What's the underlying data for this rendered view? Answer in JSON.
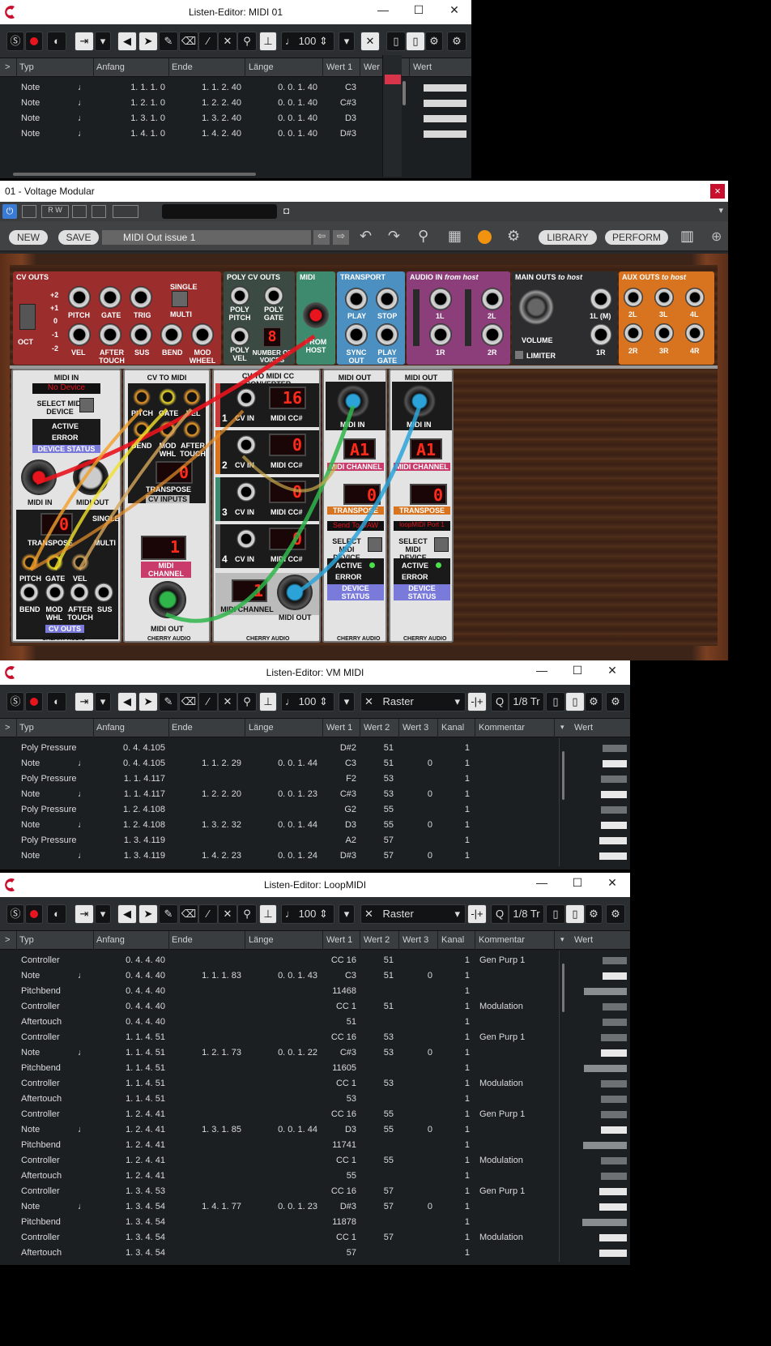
{
  "win1": {
    "title": "Listen-Editor: MIDI 01",
    "headers": [
      "Typ",
      "Anfang",
      "Ende",
      "Länge",
      "Wert 1",
      "Wer",
      "Wert"
    ],
    "quantize": "100",
    "rows": [
      {
        "typ": "Note",
        "anfang": "1. 1. 1.   0",
        "ende": "1. 1. 2. 40",
        "laenge": "0. 0. 1. 40",
        "w1": "C3",
        "bar": 0.95
      },
      {
        "typ": "Note",
        "anfang": "1. 2. 1.   0",
        "ende": "1. 2. 2. 40",
        "laenge": "0. 0. 1. 40",
        "w1": "C#3",
        "bar": 0.95
      },
      {
        "typ": "Note",
        "anfang": "1. 3. 1.   0",
        "ende": "1. 3. 2. 40",
        "laenge": "0. 0. 1. 40",
        "w1": "D3",
        "bar": 0.95
      },
      {
        "typ": "Note",
        "anfang": "1. 4. 1.   0",
        "ende": "1. 4. 2. 40",
        "laenge": "0. 0. 1. 40",
        "w1": "D#3",
        "bar": 0.95
      }
    ]
  },
  "vm": {
    "title": "01 - Voltage Modular",
    "close": "×",
    "buttons": {
      "new": "NEW",
      "save": "SAVE",
      "library": "LIBRARY",
      "perform": "PERFORM"
    },
    "preset": "MIDI Out issue 1",
    "modules": {
      "cv_outs": "CV OUTS",
      "oct": "OCT",
      "single": "SINGLE",
      "multi": "MULTI",
      "pitch": "PITCH",
      "gate": "GATE",
      "trig": "TRIG",
      "vel": "VEL",
      "aftertouch": "AFTER TOUCH",
      "sus": "SUS",
      "bend": "BEND",
      "modwheel": "MOD WHEEL",
      "oct_vals": [
        "+2",
        "+1",
        "0",
        "-1",
        "-2"
      ],
      "poly_cv": "POLY CV OUTS",
      "poly_pitch": "POLY PITCH",
      "poly_gate": "POLY GATE",
      "poly_vel": "POLY VEL",
      "voices": "NUMBER OF VOICES",
      "voices_val": "8",
      "midi": "MIDI",
      "from_host": "FROM HOST",
      "transport": "TRANSPORT",
      "play": "PLAY",
      "stop": "STOP",
      "sync_out": "SYNC OUT",
      "play_gate": "PLAY GATE",
      "audio_in": "AUDIO IN",
      "from_host_it": "from host",
      "l1": "1L",
      "l2": "2L",
      "r1": "1R",
      "r2": "2R",
      "main_outs": "MAIN OUTS",
      "to_host": "to host",
      "volume": "VOLUME",
      "limiter": "LIMITER",
      "l1m": "1L (M)",
      "aux_outs": "AUX OUTS",
      "aux": [
        "2L",
        "3L",
        "4L",
        "2R",
        "3R",
        "4R"
      ],
      "midi_in": "MIDI IN",
      "no_device": "No Device",
      "select_dev": "SELECT MIDI DEVICE",
      "active": "ACTIVE",
      "error": "ERROR",
      "dev_status": "DEVICE STATUS",
      "midi_out_lbl": "MIDI OUT",
      "transpose": "TRANSPOSE",
      "transpose_val": "0",
      "cv_to_midi": "CV TO MIDI",
      "cv_inputs": "CV INPUTS",
      "midi_channel": "MIDI CHANNEL",
      "ch_val": "1",
      "mod_whl": "MOD WHL",
      "cv_cc": "CV TO MIDI CC CONVERTER",
      "cv_in": "CV IN",
      "midi_cc": "MIDI CC#",
      "cc_vals": [
        "16",
        "0",
        "0",
        "0"
      ],
      "cc_nums": [
        "1",
        "2",
        "3",
        "4"
      ],
      "midi_out": "MIDI OUT",
      "ch_a1": "A1",
      "send_daw": "Send To DAW",
      "loopmidi": "loopMIDI Port 1",
      "maker": "CHERRY AUDIO"
    }
  },
  "win2": {
    "title": "Listen-Editor: VM MIDI",
    "raster": "Raster",
    "quant": "1/8",
    "tr": "Tr",
    "quantize": "100",
    "headers": [
      "Typ",
      "Anfang",
      "Ende",
      "Länge",
      "Wert 1",
      "Wert 2",
      "Wert 3",
      "Kanal",
      "Kommentar",
      "Wert"
    ],
    "rows": [
      {
        "typ": "Poly Pressure",
        "note": false,
        "anfang": "0. 4. 4.105",
        "ende": "",
        "laenge": "",
        "w1": "D#2",
        "w2": "51",
        "w3": "",
        "k": "1",
        "c": "",
        "bar": 0.4
      },
      {
        "typ": "Note",
        "note": true,
        "anfang": "0. 4. 4.105",
        "ende": "1. 1. 2. 29",
        "laenge": "0. 0. 1. 44",
        "w1": "C3",
        "w2": "51",
        "w3": "0",
        "k": "1",
        "c": "",
        "bar": 0.4
      },
      {
        "typ": "Poly Pressure",
        "note": false,
        "anfang": "1. 1. 4.117",
        "ende": "",
        "laenge": "",
        "w1": "F2",
        "w2": "53",
        "w3": "",
        "k": "1",
        "c": "",
        "bar": 0.42
      },
      {
        "typ": "Note",
        "note": true,
        "anfang": "1. 1. 4.117",
        "ende": "1. 2. 2. 20",
        "laenge": "0. 0. 1. 23",
        "w1": "C#3",
        "w2": "53",
        "w3": "0",
        "k": "1",
        "c": "",
        "bar": 0.42
      },
      {
        "typ": "Poly Pressure",
        "note": false,
        "anfang": "1. 2. 4.108",
        "ende": "",
        "laenge": "",
        "w1": "G2",
        "w2": "55",
        "w3": "",
        "k": "1",
        "c": "",
        "bar": 0.43
      },
      {
        "typ": "Note",
        "note": true,
        "anfang": "1. 2. 4.108",
        "ende": "1. 3. 2. 32",
        "laenge": "0. 0. 1. 44",
        "w1": "D3",
        "w2": "55",
        "w3": "0",
        "k": "1",
        "c": "",
        "bar": 0.43
      },
      {
        "typ": "Poly Pressure",
        "note": false,
        "anfang": "1. 3. 4.119",
        "ende": "",
        "laenge": "",
        "w1": "A2",
        "w2": "57",
        "w3": "",
        "k": "1",
        "c": "",
        "bar": 0.45
      },
      {
        "typ": "Note",
        "note": true,
        "anfang": "1. 3. 4.119",
        "ende": "1. 4. 2. 23",
        "laenge": "0. 0. 1. 24",
        "w1": "D#3",
        "w2": "57",
        "w3": "0",
        "k": "1",
        "c": "",
        "bar": 0.45
      }
    ]
  },
  "win3": {
    "title": "Listen-Editor: LoopMIDI",
    "raster": "Raster",
    "quant": "1/8",
    "tr": "Tr",
    "quantize": "100",
    "headers": [
      "Typ",
      "Anfang",
      "Ende",
      "Länge",
      "Wert 1",
      "Wert 2",
      "Wert 3",
      "Kanal",
      "Kommentar",
      "Wert"
    ],
    "rows": [
      {
        "typ": "Controller",
        "note": false,
        "anfang": "0. 4. 4. 40",
        "ende": "",
        "laenge": "",
        "w1": "CC 16",
        "w2": "51",
        "w3": "",
        "k": "1",
        "c": "Gen Purp 1",
        "bar": 0.4
      },
      {
        "typ": "Note",
        "note": true,
        "anfang": "0. 4. 4. 40",
        "ende": "1. 1. 1. 83",
        "laenge": "0. 0. 1. 43",
        "w1": "C3",
        "w2": "51",
        "w3": "0",
        "k": "1",
        "c": "",
        "bar": 0.4
      },
      {
        "typ": "Pitchbend",
        "note": false,
        "anfang": "0. 4. 4. 40",
        "ende": "",
        "laenge": "",
        "w1": "11468",
        "w2": "",
        "w3": "",
        "k": "1",
        "c": "",
        "bar": 0.7
      },
      {
        "typ": "Controller",
        "note": false,
        "anfang": "0. 4. 4. 40",
        "ende": "",
        "laenge": "",
        "w1": "CC 1",
        "w2": "51",
        "w3": "",
        "k": "1",
        "c": "Modulation",
        "bar": 0.4
      },
      {
        "typ": "Aftertouch",
        "note": false,
        "anfang": "0. 4. 4. 40",
        "ende": "",
        "laenge": "",
        "w1": "51",
        "w2": "",
        "w3": "",
        "k": "1",
        "c": "",
        "bar": 0.4
      },
      {
        "typ": "Controller",
        "note": false,
        "anfang": "1. 1. 4. 51",
        "ende": "",
        "laenge": "",
        "w1": "CC 16",
        "w2": "53",
        "w3": "",
        "k": "1",
        "c": "Gen Purp 1",
        "bar": 0.42
      },
      {
        "typ": "Note",
        "note": true,
        "anfang": "1. 1. 4. 51",
        "ende": "1. 2. 1. 73",
        "laenge": "0. 0. 1. 22",
        "w1": "C#3",
        "w2": "53",
        "w3": "0",
        "k": "1",
        "c": "",
        "bar": 0.42
      },
      {
        "typ": "Pitchbend",
        "note": false,
        "anfang": "1. 1. 4. 51",
        "ende": "",
        "laenge": "",
        "w1": "11605",
        "w2": "",
        "w3": "",
        "k": "1",
        "c": "",
        "bar": 0.71
      },
      {
        "typ": "Controller",
        "note": false,
        "anfang": "1. 1. 4. 51",
        "ende": "",
        "laenge": "",
        "w1": "CC 1",
        "w2": "53",
        "w3": "",
        "k": "1",
        "c": "Modulation",
        "bar": 0.42
      },
      {
        "typ": "Aftertouch",
        "note": false,
        "anfang": "1. 1. 4. 51",
        "ende": "",
        "laenge": "",
        "w1": "53",
        "w2": "",
        "w3": "",
        "k": "1",
        "c": "",
        "bar": 0.42
      },
      {
        "typ": "Controller",
        "note": false,
        "anfang": "1. 2. 4. 41",
        "ende": "",
        "laenge": "",
        "w1": "CC 16",
        "w2": "55",
        "w3": "",
        "k": "1",
        "c": "Gen Purp 1",
        "bar": 0.43
      },
      {
        "typ": "Note",
        "note": true,
        "anfang": "1. 2. 4. 41",
        "ende": "1. 3. 1. 85",
        "laenge": "0. 0. 1. 44",
        "w1": "D3",
        "w2": "55",
        "w3": "0",
        "k": "1",
        "c": "",
        "bar": 0.43
      },
      {
        "typ": "Pitchbend",
        "note": false,
        "anfang": "1. 2. 4. 41",
        "ende": "",
        "laenge": "",
        "w1": "11741",
        "w2": "",
        "w3": "",
        "k": "1",
        "c": "",
        "bar": 0.72
      },
      {
        "typ": "Controller",
        "note": false,
        "anfang": "1. 2. 4. 41",
        "ende": "",
        "laenge": "",
        "w1": "CC 1",
        "w2": "55",
        "w3": "",
        "k": "1",
        "c": "Modulation",
        "bar": 0.43
      },
      {
        "typ": "Aftertouch",
        "note": false,
        "anfang": "1. 2. 4. 41",
        "ende": "",
        "laenge": "",
        "w1": "55",
        "w2": "",
        "w3": "",
        "k": "1",
        "c": "",
        "bar": 0.43
      },
      {
        "typ": "Controller",
        "note": false,
        "anfang": "1. 3. 4. 53",
        "ende": "",
        "laenge": "",
        "w1": "CC 16",
        "w2": "57",
        "w3": "",
        "k": "1",
        "c": "Gen Purp 1",
        "bar": 0.45
      },
      {
        "typ": "Note",
        "note": true,
        "anfang": "1. 3. 4. 54",
        "ende": "1. 4. 1. 77",
        "laenge": "0. 0. 1. 23",
        "w1": "D#3",
        "w2": "57",
        "w3": "0",
        "k": "1",
        "c": "",
        "bar": 0.45
      },
      {
        "typ": "Pitchbend",
        "note": false,
        "anfang": "1. 3. 4. 54",
        "ende": "",
        "laenge": "",
        "w1": "11878",
        "w2": "",
        "w3": "",
        "k": "1",
        "c": "",
        "bar": 0.73
      },
      {
        "typ": "Controller",
        "note": false,
        "anfang": "1. 3. 4. 54",
        "ende": "",
        "laenge": "",
        "w1": "CC 1",
        "w2": "57",
        "w3": "",
        "k": "1",
        "c": "Modulation",
        "bar": 0.45
      },
      {
        "typ": "Aftertouch",
        "note": false,
        "anfang": "1. 3. 4. 54",
        "ende": "",
        "laenge": "",
        "w1": "57",
        "w2": "",
        "w3": "",
        "k": "1",
        "c": "",
        "bar": 0.45
      }
    ]
  }
}
